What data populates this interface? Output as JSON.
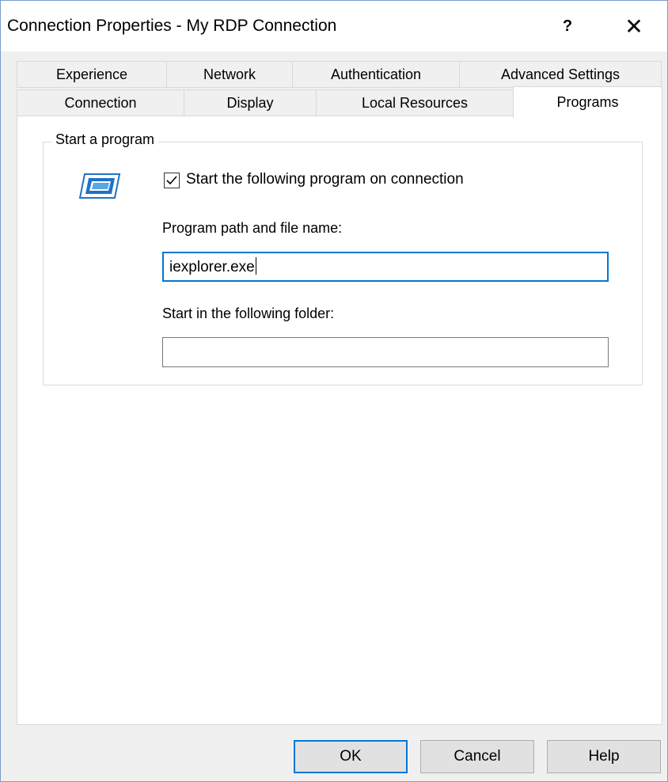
{
  "window": {
    "title": "Connection Properties - My RDP Connection",
    "help_glyph": "?",
    "close_glyph": "✕"
  },
  "tabs": {
    "row1": [
      "Experience",
      "Network",
      "Authentication",
      "Advanced Settings"
    ],
    "row2": [
      "Connection",
      "Display",
      "Local Resources",
      "Programs"
    ],
    "active": "Programs"
  },
  "programs": {
    "group_title": "Start a program",
    "icon": "program-window-icon",
    "checkbox_label": "Start the following program on connection",
    "checkbox_checked": true,
    "path_label": "Program path and file name:",
    "path_value": "iexplorer.exe",
    "folder_label": "Start in the following folder:",
    "folder_value": ""
  },
  "buttons": {
    "ok": "OK",
    "cancel": "Cancel",
    "help": "Help"
  },
  "colors": {
    "accent": "#0078d7",
    "icon_blue": "#1e73c8"
  }
}
